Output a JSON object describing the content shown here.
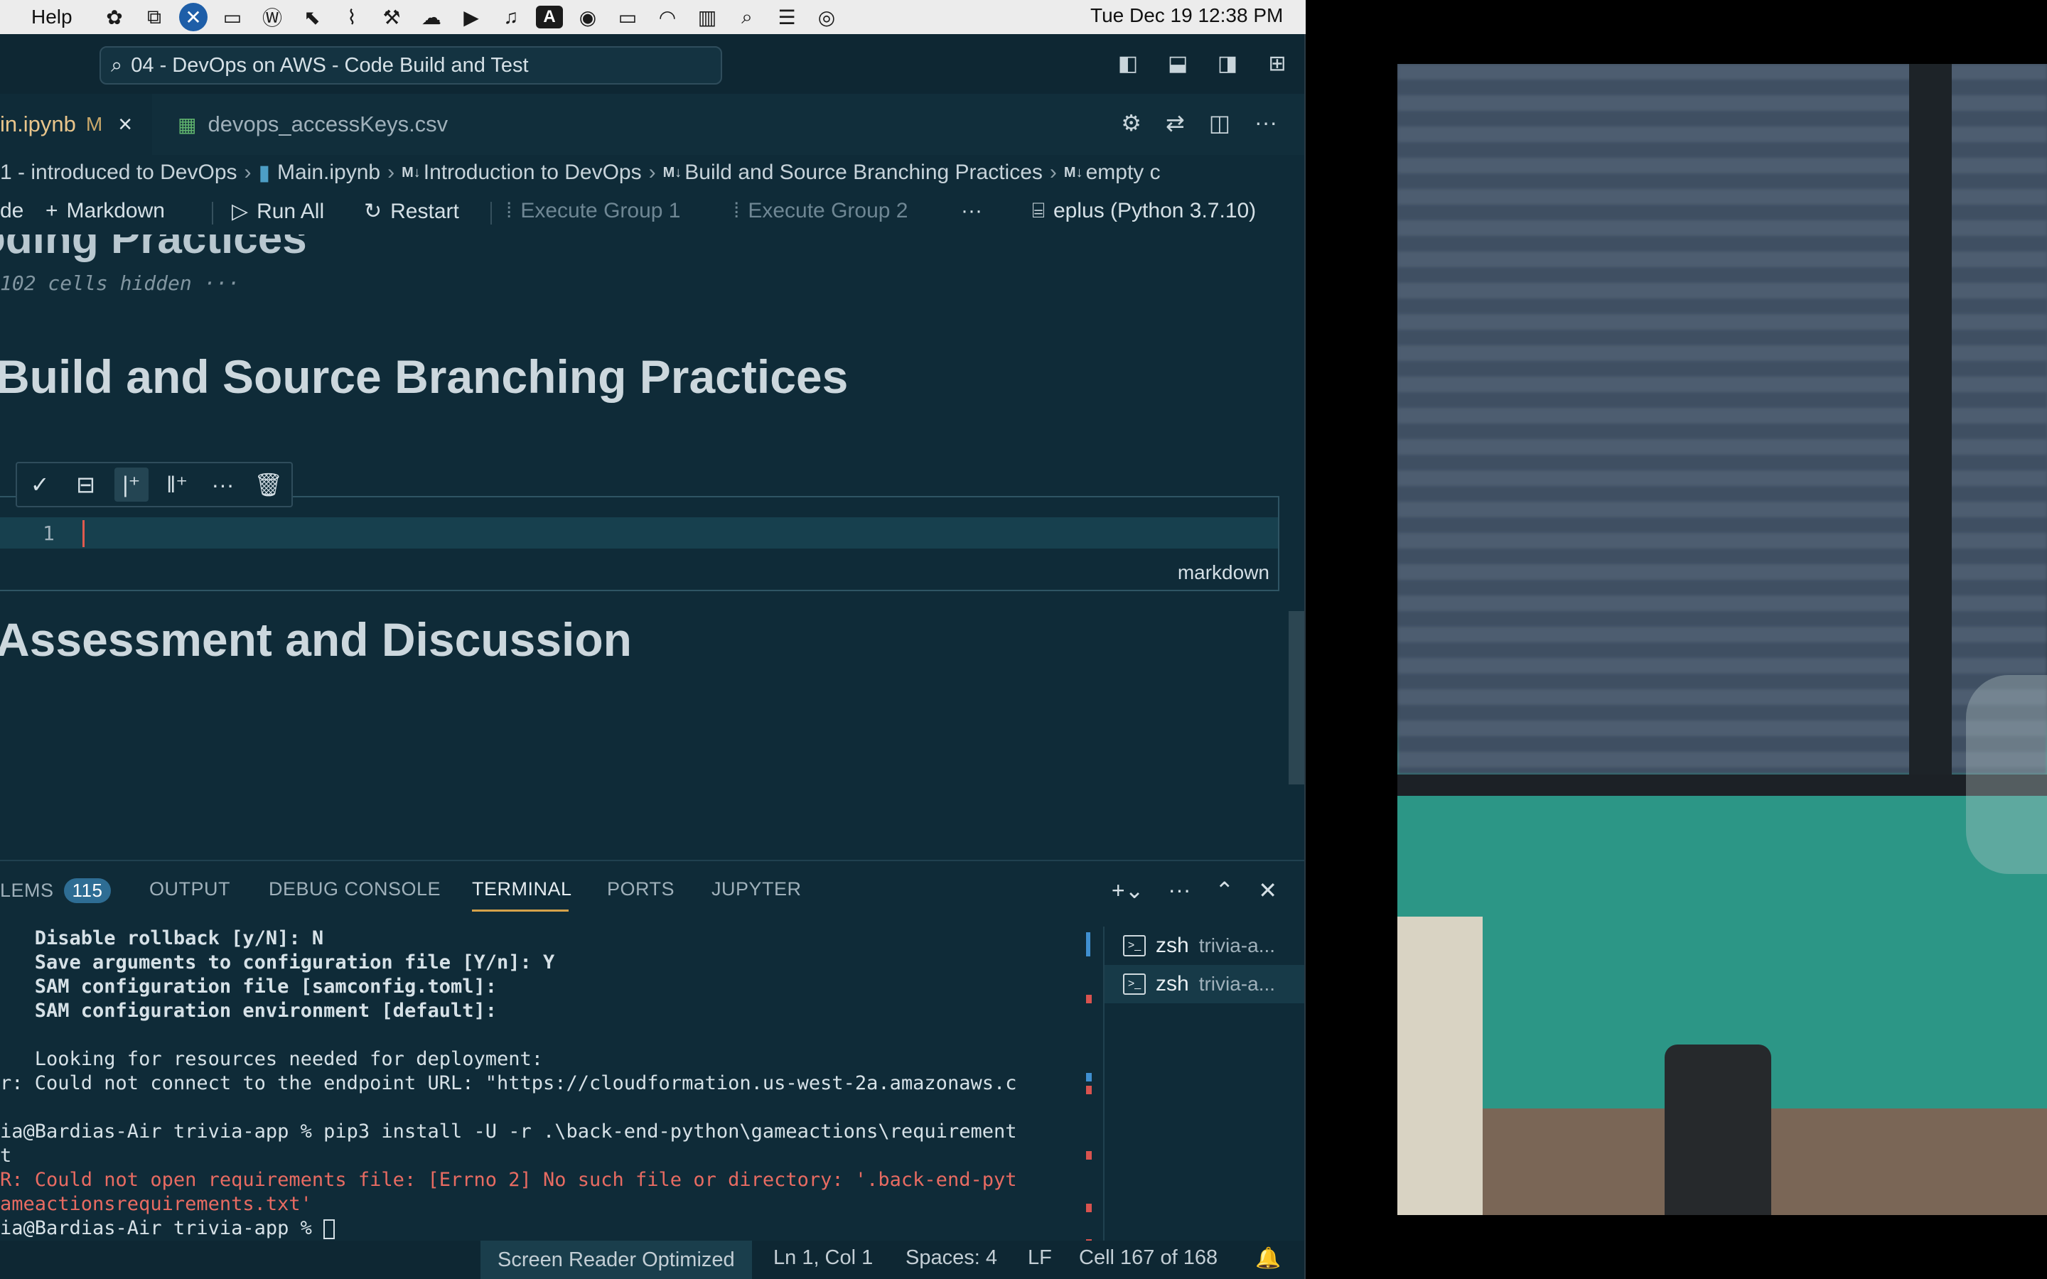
{
  "menubar": {
    "help": "Help",
    "clock": "Tue Dec 19  12:38 PM",
    "tray_icons": [
      "cloud-sync-icon",
      "screen-share-icon",
      "app-x-icon",
      "window-icon",
      "wordpress-icon",
      "cursor-icon",
      "paperclip-icon",
      "tools-icon",
      "cloud-icon",
      "play-icon",
      "headphones-icon",
      "keyboard-a-icon",
      "user-icon",
      "battery-icon",
      "wifi-icon",
      "memory-icon",
      "search-icon",
      "control-center-icon",
      "siri-icon"
    ],
    "keyboard_letter": "A"
  },
  "window": {
    "command_center": "04 - DevOps on AWS - Code Build and Test"
  },
  "tabs": [
    {
      "label": "in.ipynb",
      "modified": "M",
      "close": "×"
    },
    {
      "label": "devops_accessKeys.csv"
    }
  ],
  "breadcrumb": {
    "items": [
      "1 - introduced to DevOps",
      "Main.ipynb",
      "Introduction to DevOps",
      "Build and Source Branching Practices",
      "empty c"
    ],
    "md_marker": "M↓"
  },
  "notebook_toolbar": {
    "code": "de",
    "markdown": "Markdown",
    "run_all": "Run All",
    "restart": "Restart",
    "execute_group_1": "Execute Group 1",
    "execute_group_2": "Execute Group 2",
    "more": "···",
    "kernel": "eplus (Python 3.7.10)"
  },
  "notebook": {
    "cut_heading": "oding Practices",
    "hidden_cells": "102 cells hidden ···",
    "heading_build": "Build and Source Branching Practices",
    "cell_line_number": "1",
    "cell_language": "markdown",
    "heading_assess": "Assessment and Discussion"
  },
  "panel": {
    "tabs": [
      {
        "label": "LEMS",
        "badge": "115"
      },
      {
        "label": "OUTPUT"
      },
      {
        "label": "DEBUG CONSOLE"
      },
      {
        "label": "TERMINAL",
        "active": true
      },
      {
        "label": "PORTS"
      },
      {
        "label": "JUPYTER"
      }
    ],
    "terminal_lines": [
      {
        "text": "   Disable rollback [y/N]: N",
        "style": "b"
      },
      {
        "text": "   Save arguments to configuration file [Y/n]: Y",
        "style": "b"
      },
      {
        "text": "   SAM configuration file [samconfig.toml]:",
        "style": "b"
      },
      {
        "text": "   SAM configuration environment [default]:",
        "style": "b"
      },
      {
        "text": "",
        "style": ""
      },
      {
        "text": "   Looking for resources needed for deployment:",
        "style": ""
      },
      {
        "text": "r: Could not connect to the endpoint URL: \"https://cloudformation.us-west-2a.amazonaws.c",
        "style": ""
      },
      {
        "text": "",
        "style": ""
      },
      {
        "text": "ia@Bardias-Air trivia-app % pip3 install -U -r .\\back-end-python\\gameactions\\requirement",
        "style": ""
      },
      {
        "text": "t",
        "style": ""
      },
      {
        "text": "R: Could not open requirements file: [Errno 2] No such file or directory: '.back-end-pyt",
        "style": "err"
      },
      {
        "text": "ameactionsrequirements.txt'",
        "style": "err"
      },
      {
        "text": "ia@Bardias-Air trivia-app % ",
        "style": ""
      }
    ],
    "terminals": [
      {
        "shell": "zsh",
        "name": "trivia-a..."
      },
      {
        "shell": "zsh",
        "name": "trivia-a..."
      }
    ]
  },
  "statusbar": {
    "screen_reader": "Screen Reader Optimized",
    "position": "Ln 1, Col 1",
    "spaces": "Spaces: 4",
    "eol": "LF",
    "cell": "Cell 167 of 168"
  }
}
